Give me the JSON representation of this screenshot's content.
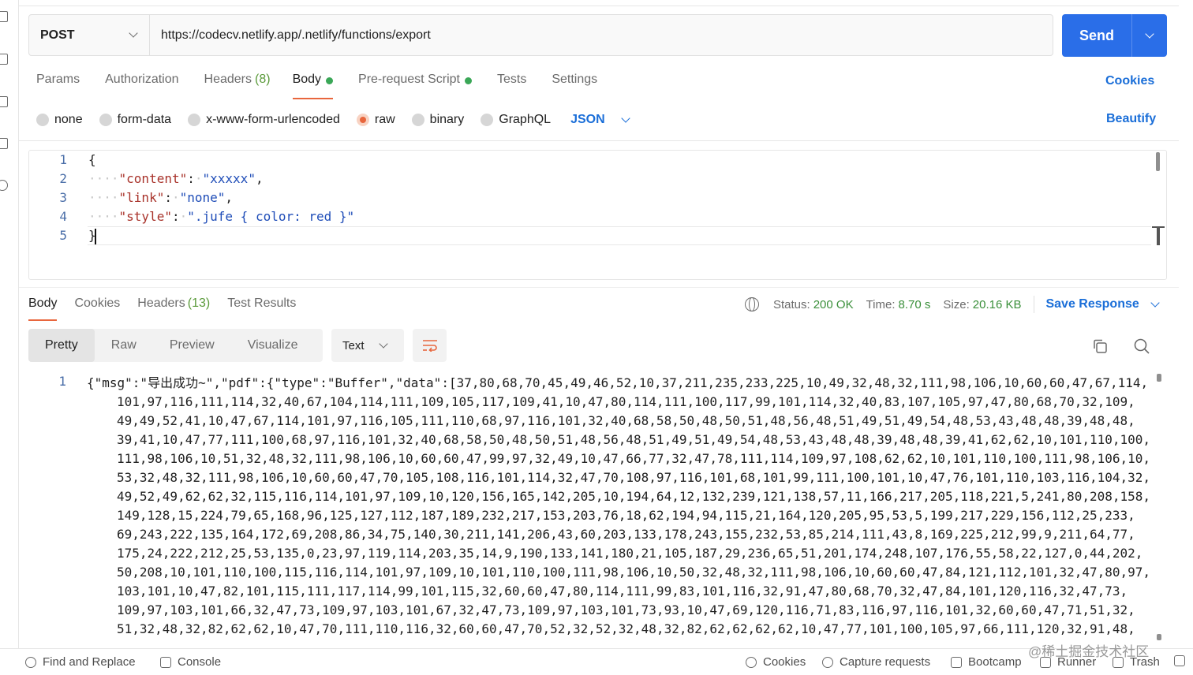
{
  "request": {
    "method": "POST",
    "url": "https://codecv.netlify.app/.netlify/functions/export",
    "send_label": "Send"
  },
  "req_tabs": {
    "params": "Params",
    "authorization": "Authorization",
    "headers": "Headers",
    "headers_count": "(8)",
    "body": "Body",
    "pre_request": "Pre-request Script",
    "tests": "Tests",
    "settings": "Settings",
    "cookies": "Cookies"
  },
  "body_types": {
    "none": "none",
    "form_data": "form-data",
    "urlencoded": "x-www-form-urlencoded",
    "raw": "raw",
    "binary": "binary",
    "graphql": "GraphQL",
    "lang": "JSON",
    "beautify": "Beautify",
    "selected": "raw"
  },
  "editor": {
    "line_numbers": [
      "1",
      "2",
      "3",
      "4",
      "5"
    ],
    "brace_open": "{",
    "brace_close": "}",
    "key1": "\"content\"",
    "val1": "\"xxxxx\"",
    "key2": "\"link\"",
    "val2": "\"none\"",
    "key3": "\"style\"",
    "val3": "\".jufe { color: red }\""
  },
  "response": {
    "tabs": {
      "body": "Body",
      "cookies": "Cookies",
      "headers": "Headers",
      "headers_count": "(13)",
      "test_results": "Test Results"
    },
    "status_label": "Status:",
    "status_value": "200 OK",
    "time_label": "Time:",
    "time_value": "8.70 s",
    "size_label": "Size:",
    "size_value": "20.16 KB",
    "save_response": "Save Response",
    "views": {
      "pretty": "Pretty",
      "raw": "Raw",
      "preview": "Preview",
      "visualize": "Visualize"
    },
    "format": "Text",
    "line_number": "1",
    "lines": [
      "{\"msg\":\"导出成功~\",\"pdf\":{\"type\":\"Buffer\",\"data\":[37,80,68,70,45,49,46,52,10,37,211,235,233,225,10,49,32,48,32,111,98,106,10,60,60,47,67,114,",
      "101,97,116,111,114,32,40,67,104,114,111,109,105,117,109,41,10,47,80,114,111,100,117,99,101,114,32,40,83,107,105,97,47,80,68,70,32,109,",
      "49,49,52,41,10,47,67,114,101,97,116,105,111,110,68,97,116,101,32,40,68,58,50,48,50,51,48,56,48,51,49,51,49,54,48,53,43,48,48,39,48,48,",
      "39,41,10,47,77,111,100,68,97,116,101,32,40,68,58,50,48,50,51,48,56,48,51,49,51,49,54,48,53,43,48,48,39,48,48,39,41,62,62,10,101,110,100,",
      "111,98,106,10,51,32,48,32,111,98,106,10,60,60,47,99,97,32,49,10,47,66,77,32,47,78,111,114,109,97,108,62,62,10,101,110,100,111,98,106,10,",
      "53,32,48,32,111,98,106,10,60,60,47,70,105,108,116,101,114,32,47,70,108,97,116,101,68,101,99,111,100,101,10,47,76,101,110,103,116,104,32,",
      "49,52,49,62,62,32,115,116,114,101,97,109,10,120,156,165,142,205,10,194,64,12,132,239,121,138,57,11,166,217,205,118,221,5,241,80,208,158,",
      "149,128,15,224,79,65,168,96,125,127,112,187,189,232,217,153,203,76,18,62,194,94,115,21,164,120,205,95,53,5,199,217,229,156,112,25,233,",
      "69,243,222,135,164,172,69,208,86,34,75,140,30,211,141,206,43,60,203,133,178,243,155,232,53,85,214,111,43,8,169,225,212,99,9,211,64,77,",
      "175,24,222,212,25,53,135,0,23,97,119,114,203,35,14,9,190,133,141,180,21,105,187,29,236,65,51,201,174,248,107,176,55,58,22,127,0,44,202,",
      "50,208,10,101,110,100,115,116,114,101,97,109,10,101,110,100,111,98,106,10,50,32,48,32,111,98,106,10,60,60,47,84,121,112,101,32,47,80,97,",
      "103,101,10,47,82,101,115,111,117,114,99,101,115,32,60,60,47,80,114,111,99,83,101,116,32,91,47,80,68,70,32,47,84,101,120,116,32,47,73,",
      "109,97,103,101,66,32,47,73,109,97,103,101,67,32,47,73,109,97,103,101,73,93,10,47,69,120,116,71,83,116,97,116,101,32,60,60,47,71,51,32,",
      "51,32,48,32,82,62,62,10,47,70,111,110,116,32,60,60,47,70,52,32,52,32,48,32,82,62,62,62,62,10,47,77,101,100,105,97,66,111,120,32,91,48,"
    ]
  },
  "status_bar": {
    "find_replace": "Find and Replace",
    "console": "Console",
    "cookies": "Cookies",
    "capture": "Capture requests",
    "bootcamp": "Bootcamp",
    "runner": "Runner",
    "trash": "Trash"
  },
  "watermark": "@稀土掘金技术社区",
  "colors": {
    "accent_blue": "#2a6ee8",
    "link_blue": "#1a6ed8",
    "active_orange": "#e8663d",
    "status_green": "#3a8f3a"
  }
}
